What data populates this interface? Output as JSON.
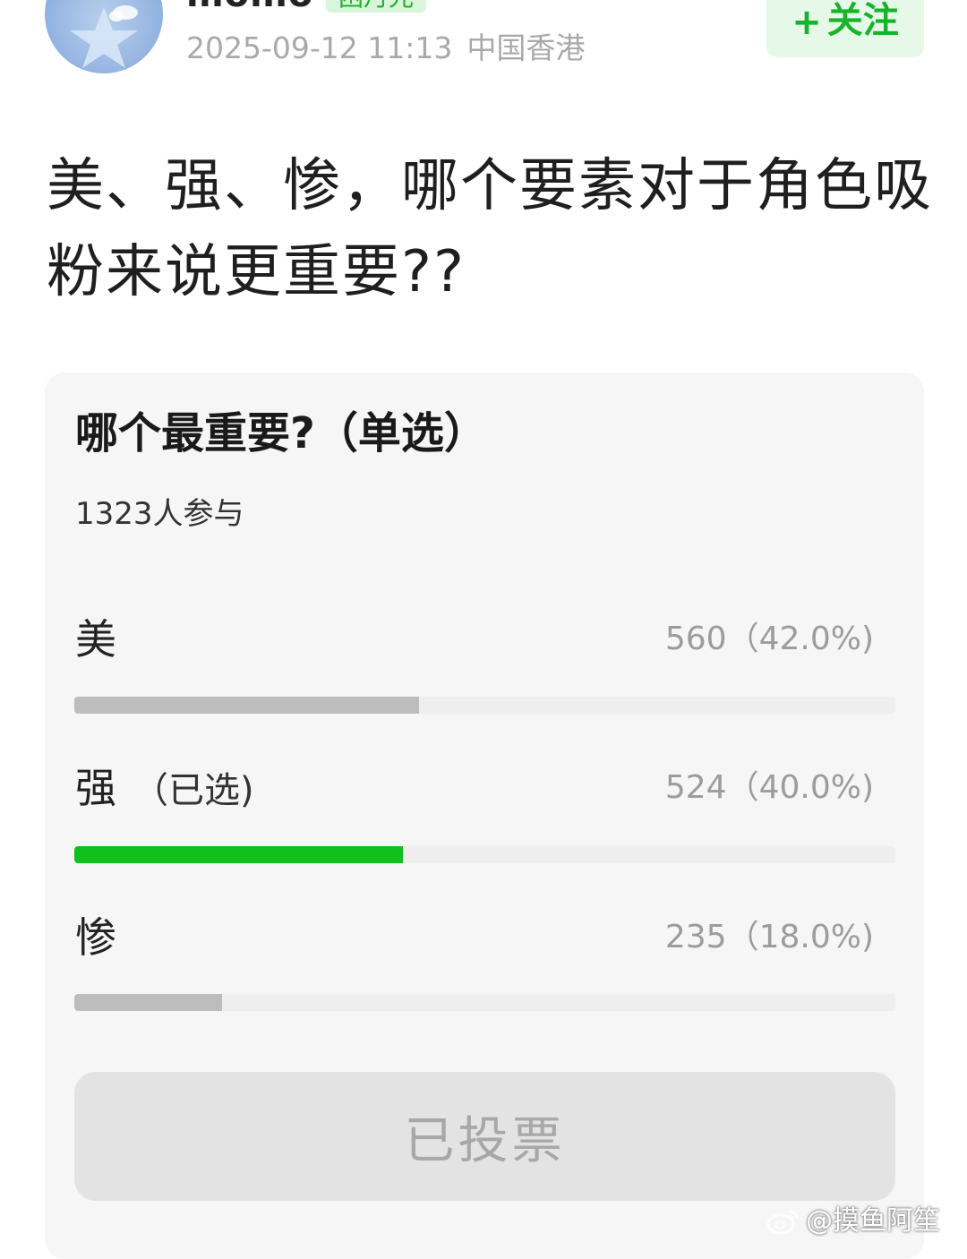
{
  "post": {
    "username": "momo",
    "badge": "困月光",
    "datetime": "2025-09-12 11:13",
    "location": "中国香港",
    "follow_label": "关注",
    "title": "美、强、惨，哪个要素对于角色吸粉来说更重要??"
  },
  "poll": {
    "question": "哪个最重要?（单选）",
    "participants": "1323人参与",
    "options": [
      {
        "label": "美",
        "selected_tag": "",
        "value_text": "560（42.0%)",
        "fraction": 0.42,
        "selected": false
      },
      {
        "label": "强",
        "selected_tag": "（已选)",
        "value_text": "524（40.0%)",
        "fraction": 0.4,
        "selected": true
      },
      {
        "label": "惨",
        "selected_tag": "",
        "value_text": "235（18.0%)",
        "fraction": 0.18,
        "selected": false
      }
    ],
    "vote_button": "已投票"
  },
  "watermark": "@摸鱼阿笙",
  "icons": {
    "avatar": "star-avatar-icon",
    "follow": "plus-icon",
    "watermark": "weibo-logo-icon"
  },
  "colors": {
    "accent_green": "#0fbf1c",
    "bar_gray": "#bdbdbd",
    "badge_green": "#1fb32b"
  }
}
